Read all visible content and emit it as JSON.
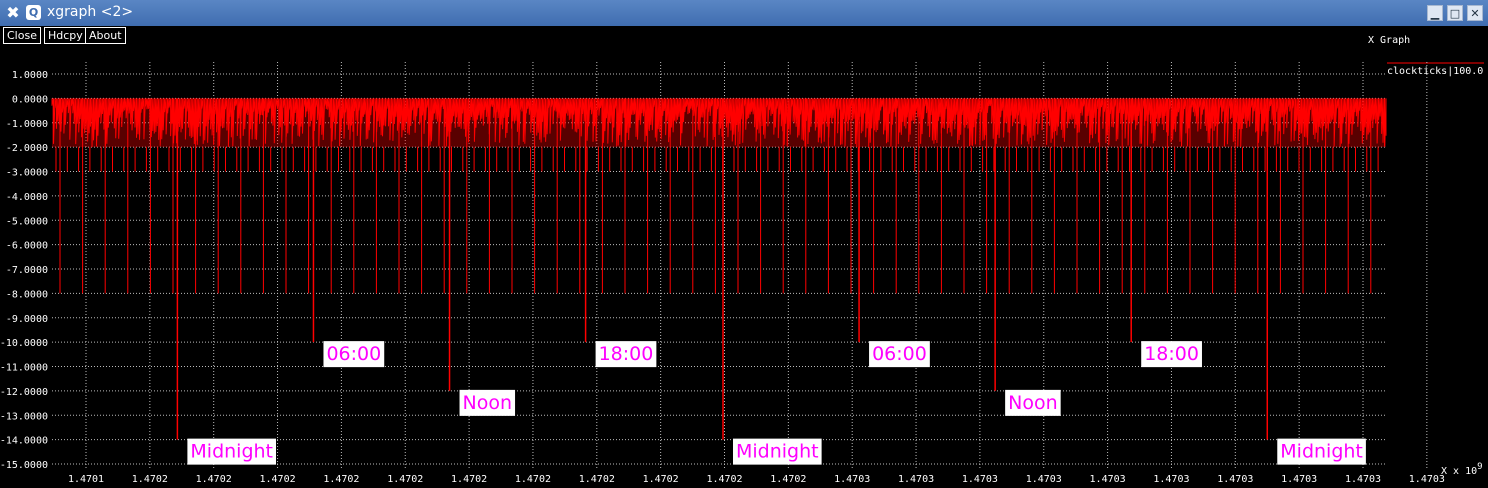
{
  "window": {
    "title": "xgraph <2>",
    "minimize": "▁",
    "maximize": "□",
    "close": "✕"
  },
  "toolbar": {
    "close_label": "Close",
    "hdcpy_label": "Hdcpy",
    "about_label": "About"
  },
  "colors": {
    "background": "#000000",
    "grid": "#cccccc",
    "axis_text": "#ffffff",
    "series": "#ff0000",
    "annotation_text": "#ff00ff",
    "annotation_bg": "#ffffff"
  },
  "chart_data": {
    "type": "line",
    "title": "X Graph",
    "xlabel": "X x 10",
    "xlabel_exponent": "9",
    "ylabel": "",
    "grid": true,
    "legend_position": "top-right",
    "x_tick_labels": [
      "1.4701",
      "1.4702",
      "1.4702",
      "1.4702",
      "1.4702",
      "1.4702",
      "1.4702",
      "1.4702",
      "1.4702",
      "1.4702",
      "1.4702",
      "1.4702",
      "1.4703",
      "1.4703",
      "1.4703",
      "1.4703",
      "1.4703",
      "1.4703",
      "1.4703",
      "1.4703",
      "1.4703",
      "1.4703"
    ],
    "y_tick_labels": [
      "1.0000",
      "0.0000",
      "-1.0000",
      "-2.0000",
      "-3.0000",
      "-4.0000",
      "-5.0000",
      "-6.0000",
      "-7.0000",
      "-8.0000",
      "-9.0000",
      "-10.0000",
      "-11.0000",
      "-12.0000",
      "-13.0000",
      "-14.0000",
      "-15.0000"
    ],
    "ylim": [
      -15,
      1
    ],
    "series": [
      {
        "name": "clockticks|100.0",
        "pattern": "oscillation between about 0 and -2 with periodic drops to -8",
        "deep_spikes": [
          {
            "x_frac": 0.094,
            "y": -14.0
          },
          {
            "x_frac": 0.196,
            "y": -10.0
          },
          {
            "x_frac": 0.298,
            "y": -12.0
          },
          {
            "x_frac": 0.4,
            "y": -10.0
          },
          {
            "x_frac": 0.503,
            "y": -14.0
          },
          {
            "x_frac": 0.605,
            "y": -10.0
          },
          {
            "x_frac": 0.707,
            "y": -12.0
          },
          {
            "x_frac": 0.809,
            "y": -10.0
          },
          {
            "x_frac": 0.911,
            "y": -14.0
          }
        ]
      }
    ],
    "annotations": [
      {
        "text": "Midnight",
        "at": -14.0,
        "spike": 0
      },
      {
        "text": "06:00",
        "at": -10.0,
        "spike": 1
      },
      {
        "text": "Noon",
        "at": -12.0,
        "spike": 2
      },
      {
        "text": "18:00",
        "at": -10.0,
        "spike": 3
      },
      {
        "text": "Midnight",
        "at": -14.0,
        "spike": 4
      },
      {
        "text": "06:00",
        "at": -10.0,
        "spike": 5
      },
      {
        "text": "Noon",
        "at": -12.0,
        "spike": 6
      },
      {
        "text": "18:00",
        "at": -10.0,
        "spike": 7
      },
      {
        "text": "Midnight",
        "at": -14.0,
        "spike": 8
      }
    ]
  }
}
